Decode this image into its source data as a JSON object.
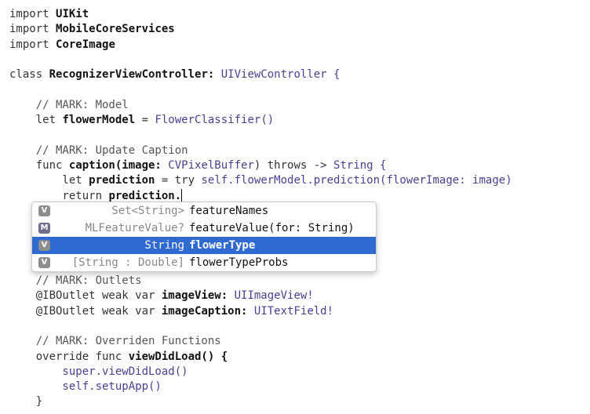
{
  "code_lines_before": [
    {
      "parts": [
        {
          "text": "import ",
          "cls": "kw"
        },
        {
          "text": "UIKit",
          "cls": "id"
        }
      ]
    },
    {
      "parts": [
        {
          "text": "import ",
          "cls": "kw"
        },
        {
          "text": "MobileCoreServices",
          "cls": "id"
        }
      ]
    },
    {
      "parts": [
        {
          "text": "import ",
          "cls": "kw"
        },
        {
          "text": "CoreImage",
          "cls": "id"
        }
      ]
    },
    {
      "parts": []
    },
    {
      "parts": [
        {
          "text": "class ",
          "cls": "kw"
        },
        {
          "text": "RecognizerViewController: ",
          "cls": "id"
        },
        {
          "text": "UIViewController {",
          "cls": "ty"
        }
      ]
    },
    {
      "parts": []
    },
    {
      "parts": [
        {
          "text": "    // MARK: Model",
          "cls": "cm"
        }
      ]
    },
    {
      "parts": [
        {
          "text": "    let ",
          "cls": "kw"
        },
        {
          "text": "flowerModel",
          "cls": "id"
        },
        {
          "text": " = ",
          "cls": "kw"
        },
        {
          "text": "FlowerClassifier()",
          "cls": "ty"
        }
      ]
    },
    {
      "parts": []
    },
    {
      "parts": [
        {
          "text": "    // MARK: Update Caption",
          "cls": "cm"
        }
      ]
    },
    {
      "parts": [
        {
          "text": "    func ",
          "cls": "kw"
        },
        {
          "text": "caption(image: ",
          "cls": "id"
        },
        {
          "text": "CVPixelBuffer",
          "cls": "ty"
        },
        {
          "text": ") throws -> ",
          "cls": "kw"
        },
        {
          "text": "String {",
          "cls": "ty"
        }
      ]
    },
    {
      "parts": [
        {
          "text": "        let ",
          "cls": "kw"
        },
        {
          "text": "prediction",
          "cls": "id"
        },
        {
          "text": " = try ",
          "cls": "kw"
        },
        {
          "text": "self.flowerModel.prediction(flowerImage: image)",
          "cls": "ty"
        }
      ]
    },
    {
      "parts": [
        {
          "text": "        return ",
          "cls": "kw"
        },
        {
          "text": "prediction.",
          "cls": "id"
        }
      ],
      "caret": true
    }
  ],
  "autocomplete": {
    "items": [
      {
        "badge": "V",
        "badge_color": "#8d8d8d",
        "type": "Set<String>",
        "name": "featureNames",
        "selected": false
      },
      {
        "badge": "M",
        "badge_color": "#6f6f8c",
        "type": "MLFeatureValue?",
        "name": "featureValue(for: String)",
        "selected": false
      },
      {
        "badge": "V",
        "badge_color": "#8d8d8d",
        "type": "String",
        "name": "flowerType",
        "selected": true
      },
      {
        "badge": "V",
        "badge_color": "#8d8d8d",
        "type": "[String : Double]",
        "name": "flowerTypeProbs",
        "selected": false
      }
    ]
  },
  "code_lines_after": [
    {
      "parts": [
        {
          "text": "    // MARK: Outlets",
          "cls": "cm"
        }
      ]
    },
    {
      "parts": [
        {
          "text": "    @IBOutlet weak var ",
          "cls": "kw"
        },
        {
          "text": "imageView: ",
          "cls": "id"
        },
        {
          "text": "UIImageView!",
          "cls": "ty"
        }
      ]
    },
    {
      "parts": [
        {
          "text": "    @IBOutlet weak var ",
          "cls": "kw"
        },
        {
          "text": "imageCaption: ",
          "cls": "id"
        },
        {
          "text": "UITextField!",
          "cls": "ty"
        }
      ]
    },
    {
      "parts": []
    },
    {
      "parts": [
        {
          "text": "    // MARK: Overriden Functions",
          "cls": "cm"
        }
      ]
    },
    {
      "parts": [
        {
          "text": "    override func ",
          "cls": "kw"
        },
        {
          "text": "viewDidLoad() {",
          "cls": "id"
        }
      ]
    },
    {
      "parts": [
        {
          "text": "        super.viewDidLoad()",
          "cls": "ty"
        }
      ]
    },
    {
      "parts": [
        {
          "text": "        self.setupApp()",
          "cls": "ty"
        }
      ]
    },
    {
      "parts": [
        {
          "text": "    }",
          "cls": "kw"
        }
      ]
    }
  ]
}
